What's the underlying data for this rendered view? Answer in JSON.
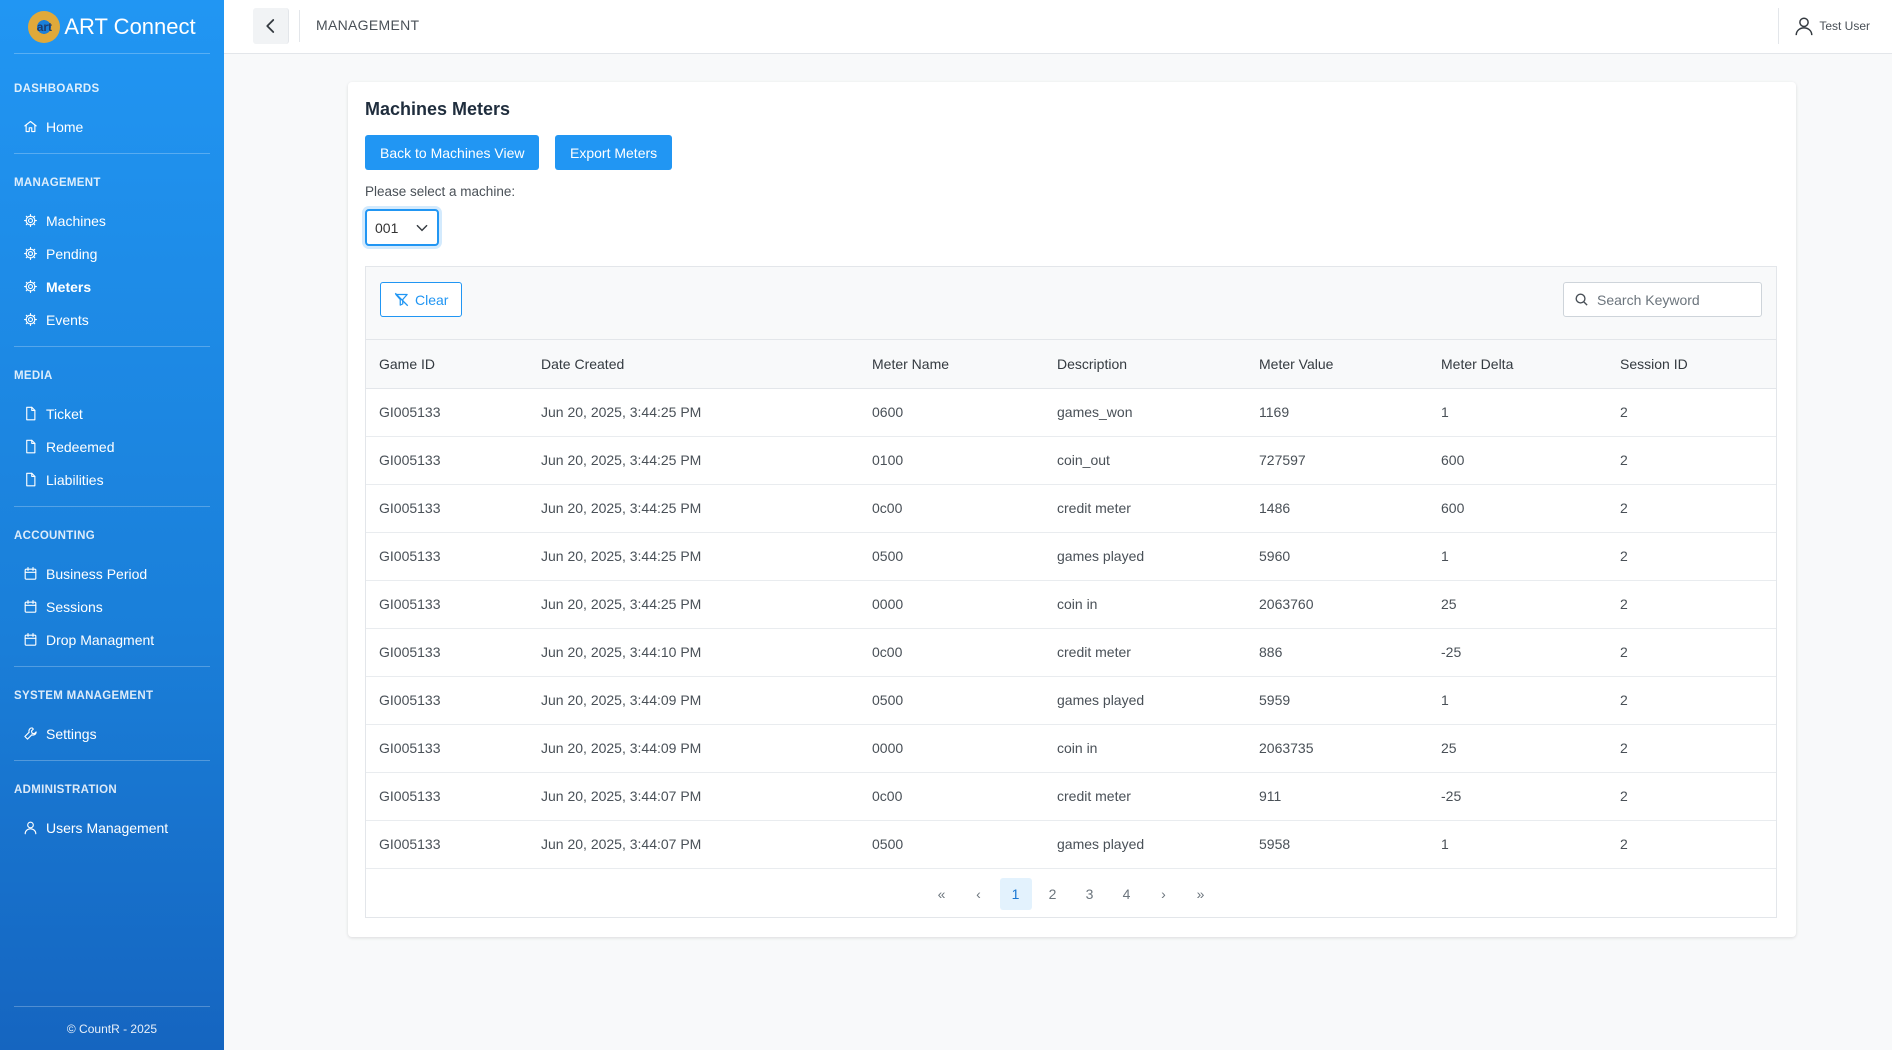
{
  "app": {
    "logo_mark": "art",
    "name": "ART Connect",
    "footer": "© CountR - 2025"
  },
  "sidebar": {
    "sections": [
      {
        "title": "DASHBOARDS",
        "items": [
          {
            "label": "Home",
            "icon": "home-icon"
          }
        ]
      },
      {
        "title": "MANAGEMENT",
        "items": [
          {
            "label": "Machines",
            "icon": "gear-icon"
          },
          {
            "label": "Pending",
            "icon": "gear-icon"
          },
          {
            "label": "Meters",
            "icon": "gear-icon",
            "active": true
          },
          {
            "label": "Events",
            "icon": "gear-icon"
          }
        ]
      },
      {
        "title": "MEDIA",
        "items": [
          {
            "label": "Ticket",
            "icon": "file-icon"
          },
          {
            "label": "Redeemed",
            "icon": "file-icon"
          },
          {
            "label": "Liabilities",
            "icon": "file-icon"
          }
        ]
      },
      {
        "title": "ACCOUNTING",
        "items": [
          {
            "label": "Business Period",
            "icon": "calendar-icon"
          },
          {
            "label": "Sessions",
            "icon": "calendar-icon"
          },
          {
            "label": "Drop Managment",
            "icon": "calendar-icon"
          }
        ]
      },
      {
        "title": "SYSTEM MANAGEMENT",
        "items": [
          {
            "label": "Settings",
            "icon": "wrench-icon"
          }
        ]
      },
      {
        "title": "ADMINISTRATION",
        "items": [
          {
            "label": "Users Management",
            "icon": "user-icon"
          }
        ]
      }
    ]
  },
  "topbar": {
    "title": "MANAGEMENT",
    "user": "Test User"
  },
  "card": {
    "title": "Machines Meters",
    "back_button": "Back to Machines View",
    "export_button": "Export Meters",
    "select_label": "Please select a machine:",
    "selected_machine": "001"
  },
  "table": {
    "clear_label": "Clear",
    "search_placeholder": "Search Keyword",
    "columns": [
      "Game ID",
      "Date Created",
      "Meter Name",
      "Description",
      "Meter Value",
      "Meter Delta",
      "Session ID"
    ],
    "rows": [
      [
        "GI005133",
        "Jun 20, 2025, 3:44:25 PM",
        "0600",
        "games_won",
        "1169",
        "1",
        "2"
      ],
      [
        "GI005133",
        "Jun 20, 2025, 3:44:25 PM",
        "0100",
        "coin_out",
        "727597",
        "600",
        "2"
      ],
      [
        "GI005133",
        "Jun 20, 2025, 3:44:25 PM",
        "0c00",
        "credit meter",
        "1486",
        "600",
        "2"
      ],
      [
        "GI005133",
        "Jun 20, 2025, 3:44:25 PM",
        "0500",
        "games played",
        "5960",
        "1",
        "2"
      ],
      [
        "GI005133",
        "Jun 20, 2025, 3:44:25 PM",
        "0000",
        "coin in",
        "2063760",
        "25",
        "2"
      ],
      [
        "GI005133",
        "Jun 20, 2025, 3:44:10 PM",
        "0c00",
        "credit meter",
        "886",
        "-25",
        "2"
      ],
      [
        "GI005133",
        "Jun 20, 2025, 3:44:09 PM",
        "0500",
        "games played",
        "5959",
        "1",
        "2"
      ],
      [
        "GI005133",
        "Jun 20, 2025, 3:44:09 PM",
        "0000",
        "coin in",
        "2063735",
        "25",
        "2"
      ],
      [
        "GI005133",
        "Jun 20, 2025, 3:44:07 PM",
        "0c00",
        "credit meter",
        "911",
        "-25",
        "2"
      ],
      [
        "GI005133",
        "Jun 20, 2025, 3:44:07 PM",
        "0500",
        "games played",
        "5958",
        "1",
        "2"
      ]
    ]
  },
  "pagination": {
    "first": "«",
    "prev": "‹",
    "pages": [
      "1",
      "2",
      "3",
      "4"
    ],
    "active_page": "1",
    "next": "›",
    "last": "»"
  },
  "colors": {
    "primary": "#2196f3",
    "sidebar_top": "#2196f3",
    "sidebar_bottom": "#1565c0"
  }
}
